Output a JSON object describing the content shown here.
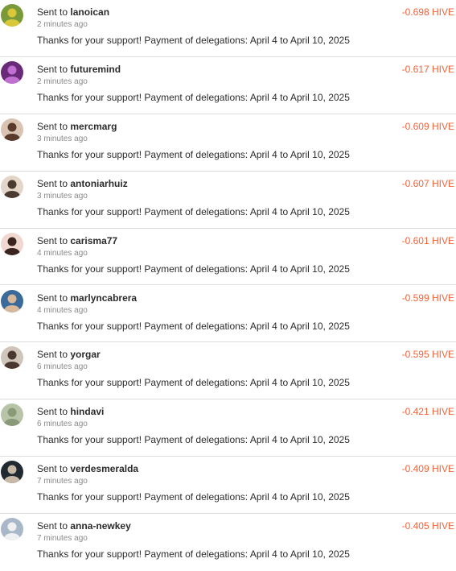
{
  "colors": {
    "amount": "#f0643c",
    "divider": "#dcdcdc",
    "muted": "#8a8a8a",
    "text": "#2b2b2b"
  },
  "transfers": [
    {
      "prefix": "Sent to",
      "username": "lanoican",
      "time": "2 minutes ago",
      "memo": "Thanks for your support! Payment of delegations: April 4 to April 10, 2025",
      "amount": "-0.698 HIVE",
      "avatar": {
        "icon": "user-avatar-icon",
        "bg": "#7a9a3a",
        "fg": "#d8c83a"
      }
    },
    {
      "prefix": "Sent to",
      "username": "futuremind",
      "time": "2 minutes ago",
      "memo": "Thanks for your support! Payment of delegations: April 4 to April 10, 2025",
      "amount": "-0.617 HIVE",
      "avatar": {
        "icon": "user-avatar-icon",
        "bg": "#6a2a7a",
        "fg": "#c070d0"
      }
    },
    {
      "prefix": "Sent to",
      "username": "mercmarg",
      "time": "3 minutes ago",
      "memo": "Thanks for your support! Payment of delegations: April 4 to April 10, 2025",
      "amount": "-0.609 HIVE",
      "avatar": {
        "icon": "user-avatar-icon",
        "bg": "#d9c4b4",
        "fg": "#5a3a2a"
      }
    },
    {
      "prefix": "Sent to",
      "username": "antoniarhuiz",
      "time": "3 minutes ago",
      "memo": "Thanks for your support! Payment of delegations: April 4 to April 10, 2025",
      "amount": "-0.607 HIVE",
      "avatar": {
        "icon": "user-avatar-icon",
        "bg": "#e3d6c8",
        "fg": "#4a3a30"
      }
    },
    {
      "prefix": "Sent to",
      "username": "carisma77",
      "time": "4 minutes ago",
      "memo": "Thanks for your support! Payment of delegations: April 4 to April 10, 2025",
      "amount": "-0.601 HIVE",
      "avatar": {
        "icon": "user-avatar-icon",
        "bg": "#f0d8d0",
        "fg": "#3a2420"
      }
    },
    {
      "prefix": "Sent to",
      "username": "marlyncabrera",
      "time": "4 minutes ago",
      "memo": "Thanks for your support! Payment of delegations: April 4 to April 10, 2025",
      "amount": "-0.599 HIVE",
      "avatar": {
        "icon": "user-avatar-icon",
        "bg": "#3a6a9a",
        "fg": "#d8b89a"
      }
    },
    {
      "prefix": "Sent to",
      "username": "yorgar",
      "time": "6 minutes ago",
      "memo": "Thanks for your support! Payment of delegations: April 4 to April 10, 2025",
      "amount": "-0.595 HIVE",
      "avatar": {
        "icon": "user-avatar-icon",
        "bg": "#cfc5bb",
        "fg": "#4a3830"
      }
    },
    {
      "prefix": "Sent to",
      "username": "hindavi",
      "time": "6 minutes ago",
      "memo": "Thanks for your support! Payment of delegations: April 4 to April 10, 2025",
      "amount": "-0.421 HIVE",
      "avatar": {
        "icon": "user-avatar-icon",
        "bg": "#b8c4a8",
        "fg": "#8a9a78"
      }
    },
    {
      "prefix": "Sent to",
      "username": "verdesmeralda",
      "time": "7 minutes ago",
      "memo": "Thanks for your support! Payment of delegations: April 4 to April 10, 2025",
      "amount": "-0.409 HIVE",
      "avatar": {
        "icon": "user-avatar-icon",
        "bg": "#202a30",
        "fg": "#c8b8a8"
      }
    },
    {
      "prefix": "Sent to",
      "username": "anna-newkey",
      "time": "7 minutes ago",
      "memo": "Thanks for your support! Payment of delegations: April 4 to April 10, 2025",
      "amount": "-0.405 HIVE",
      "avatar": {
        "icon": "user-avatar-icon",
        "bg": "#a8b8c8",
        "fg": "#f0f0f0"
      }
    }
  ]
}
